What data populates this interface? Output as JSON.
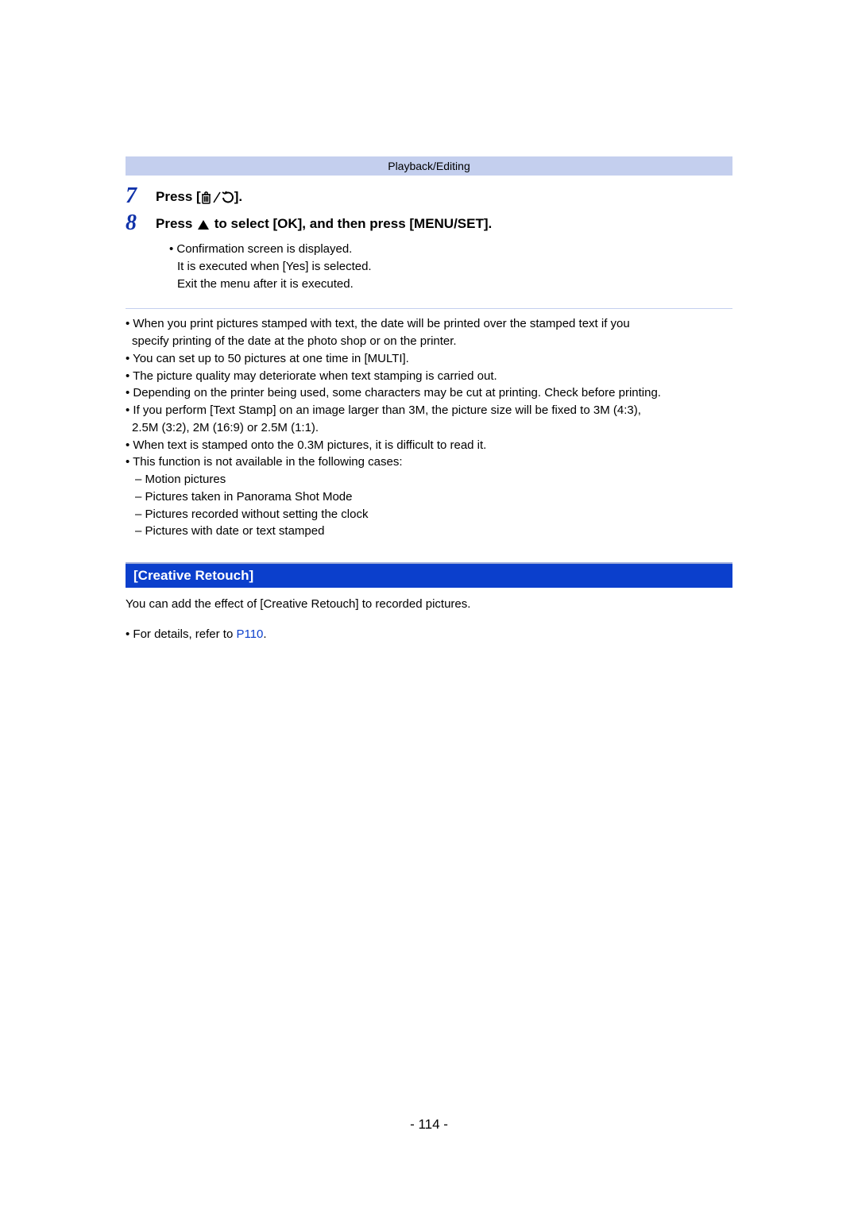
{
  "header": {
    "breadcrumb": "Playback/Editing"
  },
  "steps": {
    "step7": {
      "number": "7",
      "prefix": "Press [",
      "suffix": "]."
    },
    "step8": {
      "number": "8",
      "prefix": "Press ",
      "suffix": " to select [OK], and then press [MENU/SET]."
    }
  },
  "confirmation": {
    "line1": "• Confirmation screen is displayed.",
    "line2": "It is executed when [Yes] is selected.",
    "line3": "Exit the menu after it is executed."
  },
  "notes": {
    "n1": "• When you print pictures stamped with text, the date will be printed over the stamped text if you",
    "n1b": "specify printing of the date at the photo shop or on the printer.",
    "n2": "• You can set up to 50 pictures at one time in [MULTI].",
    "n3": "• The picture quality may deteriorate when text stamping is carried out.",
    "n4": "• Depending on the printer being used, some characters may be cut at printing. Check before printing.",
    "n5": "• If you perform [Text Stamp] on an image larger than 3M, the picture size will be fixed to 3M (4:3),",
    "n5b": "2.5M (3:2), 2M (16:9) or 2.5M (1:1).",
    "n6": "• When text is stamped onto the 0.3M pictures, it is difficult to read it.",
    "n7": "• This function is not available in the following cases:",
    "n7a": "– Motion pictures",
    "n7b": "– Pictures taken in Panorama Shot Mode",
    "n7c": "– Pictures recorded without setting the clock",
    "n7d": "– Pictures with date or text stamped"
  },
  "section": {
    "heading": "[Creative Retouch]",
    "body": "You can add the effect of [Creative Retouch] to recorded pictures.",
    "ref_prefix": "• For details, refer to ",
    "ref_link": "P110",
    "ref_suffix": "."
  },
  "page_number": "- 114 -"
}
